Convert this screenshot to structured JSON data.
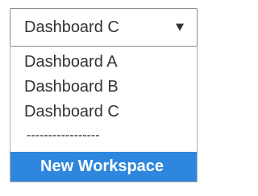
{
  "select": {
    "value": "Dashboard C"
  },
  "menu": {
    "items": [
      {
        "label": "Dashboard A"
      },
      {
        "label": "Dashboard B"
      },
      {
        "label": "Dashboard C"
      }
    ],
    "divider": "-----------------",
    "action_label": "New Workspace"
  },
  "colors": {
    "highlight": "#2e86de",
    "border": "#8a8a8a",
    "text": "#333333"
  },
  "icons": {
    "select_arrow": "chevron-down-icon"
  }
}
